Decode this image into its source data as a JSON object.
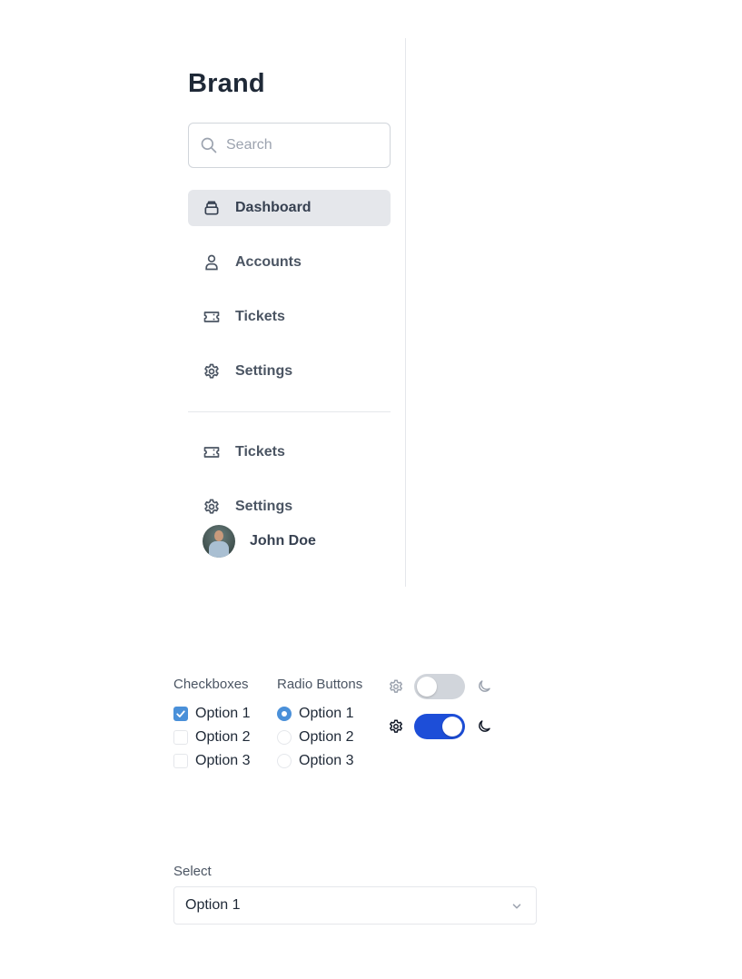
{
  "sidebar": {
    "brand": "Brand",
    "search": {
      "placeholder": "Search",
      "value": ""
    },
    "nav_items": [
      {
        "label": "Dashboard",
        "icon": "inbox-icon",
        "active": true
      },
      {
        "label": "Accounts",
        "icon": "user-icon",
        "active": false
      },
      {
        "label": "Tickets",
        "icon": "ticket-icon",
        "active": false
      },
      {
        "label": "Settings",
        "icon": "gear-icon",
        "active": false
      }
    ],
    "secondary_items": [
      {
        "label": "Tickets",
        "icon": "ticket-icon"
      },
      {
        "label": "Settings",
        "icon": "gear-icon"
      }
    ],
    "user": {
      "name": "John Doe"
    }
  },
  "checkboxes": {
    "title": "Checkboxes",
    "options": [
      {
        "label": "Option 1",
        "checked": true
      },
      {
        "label": "Option 2",
        "checked": false
      },
      {
        "label": "Option 3",
        "checked": false
      }
    ]
  },
  "radios": {
    "title": "Radio Buttons",
    "options": [
      {
        "label": "Option 1",
        "checked": true
      },
      {
        "label": "Option 2",
        "checked": false
      },
      {
        "label": "Option 3",
        "checked": false
      }
    ]
  },
  "toggles": [
    {
      "state": "off",
      "left_icon": "gear-icon",
      "right_icon": "moon-icon"
    },
    {
      "state": "on",
      "left_icon": "gear-icon",
      "right_icon": "moon-icon"
    }
  ],
  "select": {
    "label": "Select",
    "value": "Option 1"
  },
  "colors": {
    "accent": "#4a90d9",
    "toggle_on": "#1d4ed8",
    "nav_active_bg": "#e5e7eb"
  }
}
